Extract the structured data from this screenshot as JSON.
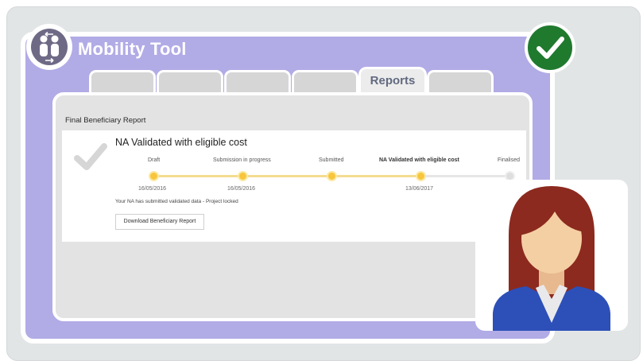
{
  "app": {
    "title": "Mobility Tool"
  },
  "tabs": [
    {
      "label": "",
      "active": false
    },
    {
      "label": "",
      "active": false
    },
    {
      "label": "",
      "active": false
    },
    {
      "label": "",
      "active": false
    },
    {
      "label": "Reports",
      "active": true
    },
    {
      "label": "",
      "active": false
    }
  ],
  "panel": {
    "header": "Final Beneficiary Report"
  },
  "report": {
    "status_title": "NA Validated with eligible cost",
    "steps": [
      {
        "label": "Draft",
        "date": "16/05/2016",
        "done": true
      },
      {
        "label": "Submission in progress",
        "date": "16/05/2016",
        "done": true
      },
      {
        "label": "Submitted",
        "date": "",
        "done": true
      },
      {
        "label": "NA Validated with eligible cost",
        "date": "13/06/2017",
        "done": true
      },
      {
        "label": "Finalised",
        "date": "",
        "done": false
      }
    ],
    "locked_message": "Your NA has submitted validated data - Project locked",
    "download_label": "Download Beneficiary Report"
  },
  "icons": {
    "logo": "people-exchange-icon",
    "badge": "checkmark-badge-icon",
    "status": "checkmark-icon",
    "avatar": "user-avatar-icon"
  },
  "colors": {
    "window": "#b1abe6",
    "progress": "#f8c63d",
    "badge": "#1f7a2e",
    "avatar_shirt": "#2d4fb8",
    "avatar_hair": "#8c2a1f"
  }
}
